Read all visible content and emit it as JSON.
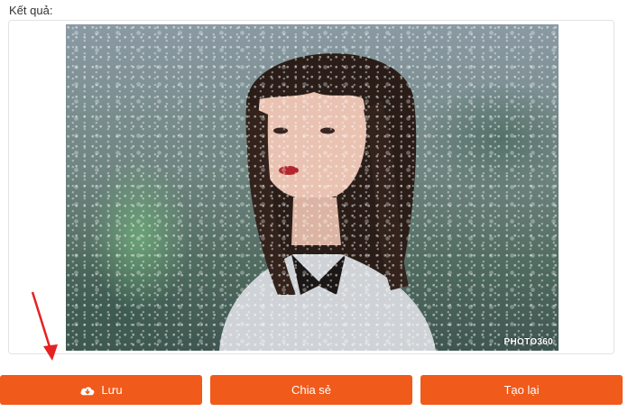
{
  "result": {
    "label": "Kết quả:",
    "watermark": "PHOTO360"
  },
  "buttons": {
    "save": "Lưu",
    "share": "Chia sẻ",
    "recreate": "Tạo lại"
  },
  "icons": {
    "save": "cloud-download-icon",
    "annotation": "red-arrow-icon"
  },
  "colors": {
    "button": "#f05a1a",
    "arrow": "#e52222"
  }
}
